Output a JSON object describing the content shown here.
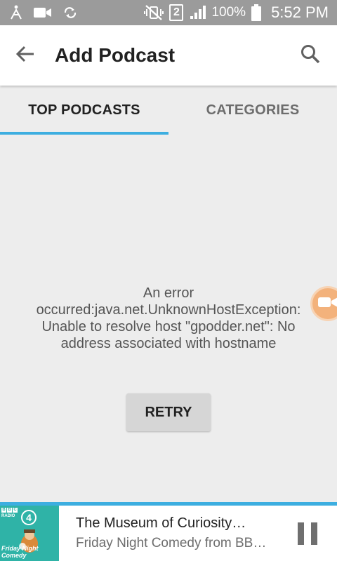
{
  "status_bar": {
    "battery": "100%",
    "time": "5:52 PM",
    "sim": "2",
    "icons": [
      "accessibility-icon",
      "video-record-icon",
      "sync-icon",
      "mute-vibrate-icon",
      "sim-icon",
      "signal-icon",
      "battery-icon"
    ]
  },
  "app_bar": {
    "title": "Add Podcast",
    "icons": [
      "back-arrow-icon",
      "search-icon"
    ]
  },
  "tabs": [
    {
      "label": "TOP PODCASTS",
      "active": true
    },
    {
      "label": "CATEGORIES",
      "active": false
    }
  ],
  "error": {
    "message": "An error occurred:java.net.UnknownHostException: Unable to resolve host \"gpodder.net\": No address associated with hostname",
    "retry_label": "RETRY"
  },
  "player": {
    "title": "The Museum of Curiosity…",
    "subtitle": "Friday Night Comedy from BB…",
    "cover": {
      "bbc": [
        "B",
        "B",
        "C"
      ],
      "radio": "RADIO",
      "channel": "4",
      "caption_line1": "Friday Night",
      "caption_line2": "Comedy"
    }
  },
  "colors": {
    "accent": "#3daee0",
    "status_bar": "#9b9b9b",
    "background": "#ededed",
    "float_bubble": "#f3b27c"
  }
}
